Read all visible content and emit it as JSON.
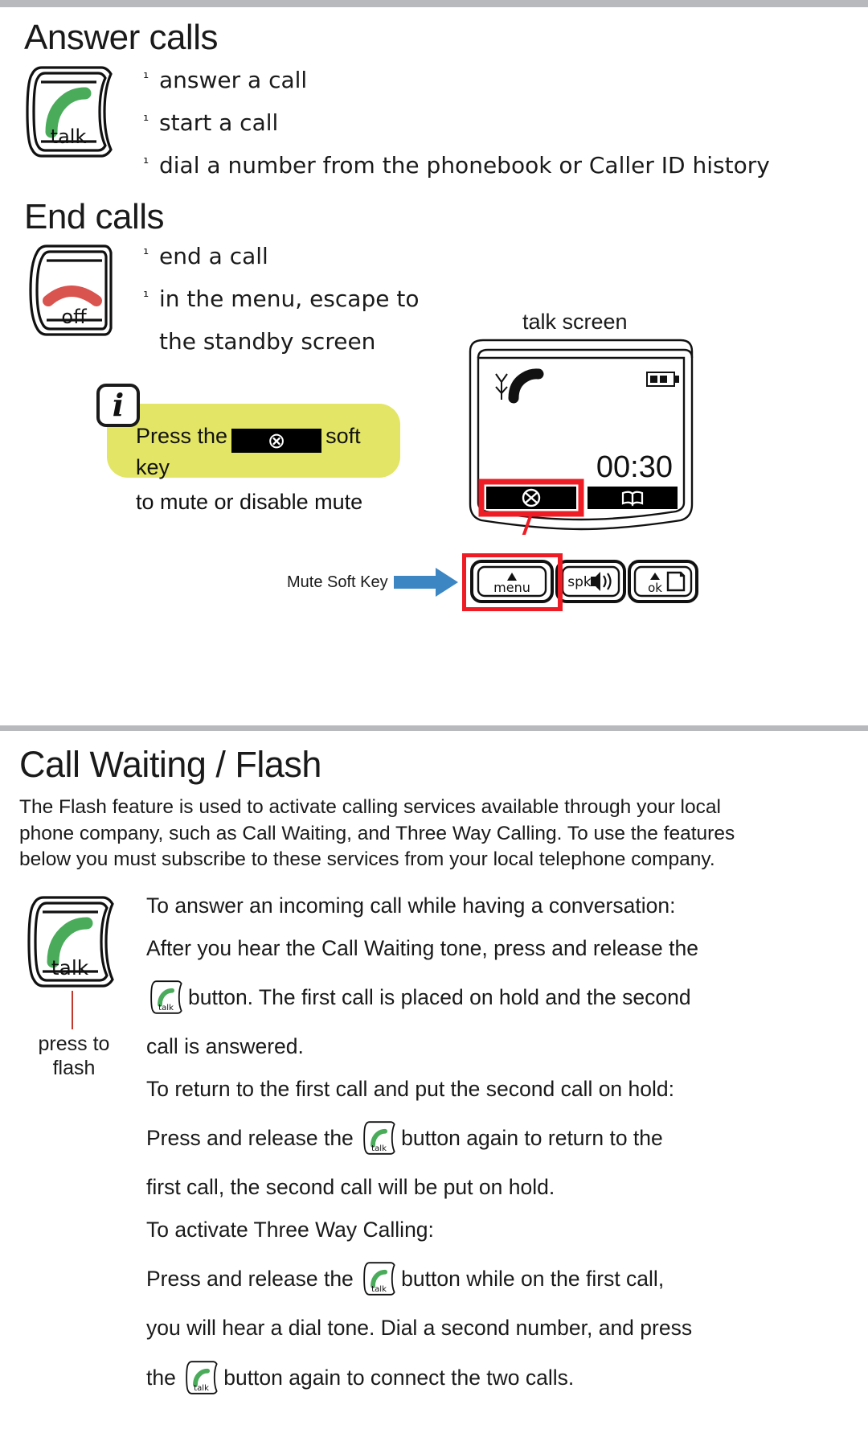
{
  "page": {
    "background": "#ffffff",
    "rule_color": "#b7b9bc"
  },
  "sections": {
    "answer_calls": {
      "title": "Answer calls",
      "key": {
        "label": "talk",
        "icon": "handset-green-icon",
        "color": "#4aac5b"
      },
      "bullets": [
        {
          "mark": "¹",
          "text": "answer a call"
        },
        {
          "mark": "¹",
          "text": "start a call"
        },
        {
          "mark": "¹",
          "text": "dial a number from the phonebook or Caller ID history"
        }
      ]
    },
    "end_calls": {
      "title": "End calls",
      "key": {
        "label": "off",
        "icon": "handset-red-icon",
        "color": "#d9534f"
      },
      "bullets": [
        {
          "mark": "¹",
          "text": "end a call"
        },
        {
          "mark": "¹",
          "text": "in the menu, escape to"
        },
        {
          "mark": "",
          "text": "the standby screen"
        }
      ]
    },
    "callout": {
      "icon": "info-icon",
      "icon_glyph": "i",
      "background": "#e3e566",
      "line1_before": "Press the",
      "softkey_glyph": "⊗",
      "softkey_name": "mute-icon",
      "line1_after": "soft key",
      "line2": "to mute or disable mute"
    },
    "talk_screen": {
      "label": "talk screen",
      "status_icons": [
        "antenna-icon",
        "handset-icon",
        "battery-icon"
      ],
      "timer": "00:30",
      "softkeys": [
        {
          "name": "mute-softkey",
          "glyph": "⊗",
          "highlighted": true,
          "highlight_color": "#ee1c25"
        },
        {
          "name": "phonebook-softkey",
          "glyph": "book-icon",
          "highlighted": false
        }
      ],
      "callout_label": "Mute Soft Key",
      "arrow_color": "#3c86c4",
      "hardware_buttons": [
        {
          "name": "menu-button",
          "label": "menu",
          "icon": "up-arrow-icon",
          "highlighted": true
        },
        {
          "name": "speaker-button",
          "label": "spk",
          "icon": "speaker-icon",
          "highlighted": false
        },
        {
          "name": "ok-button",
          "label": "ok",
          "icon": "page-icon",
          "highlighted": false
        }
      ]
    },
    "call_waiting": {
      "title": "Call Waiting / Flash",
      "intro": "The Flash feature is used to activate calling services available through your local phone company, such as Call Waiting, and Three Way Calling. To use the features below you must subscribe to these services from your local telephone company.",
      "key": {
        "label": "talk",
        "icon": "handset-green-icon",
        "color": "#4aac5b"
      },
      "key_caption_line1": "press to",
      "key_caption_line2": "flash",
      "leader_color": "#c0392b",
      "paragraphs": [
        {
          "id": "p1",
          "parts": [
            {
              "type": "text",
              "value": "To answer an incoming call while having a conversation:"
            }
          ]
        },
        {
          "id": "p2",
          "parts": [
            {
              "type": "text",
              "value": "After you hear the Call Waiting tone, press and release the"
            }
          ]
        },
        {
          "id": "p3",
          "parts": [
            {
              "type": "key",
              "value": "talk"
            },
            {
              "type": "text",
              "value": "button. The first call is placed on hold and the second"
            }
          ]
        },
        {
          "id": "p4",
          "parts": [
            {
              "type": "text",
              "value": "call is answered."
            }
          ]
        },
        {
          "id": "p5",
          "parts": [
            {
              "type": "text",
              "value": "To return to the first call and put the second call on hold:"
            }
          ]
        },
        {
          "id": "p6",
          "parts": [
            {
              "type": "text",
              "value": "Press and release the"
            },
            {
              "type": "key",
              "value": "talk"
            },
            {
              "type": "text",
              "value": "button again to return to the"
            }
          ]
        },
        {
          "id": "p7",
          "parts": [
            {
              "type": "text",
              "value": "first call, the second call will be put on hold."
            }
          ]
        },
        {
          "id": "p8",
          "parts": [
            {
              "type": "text",
              "value": "To activate Three Way Calling:"
            }
          ]
        },
        {
          "id": "p9",
          "parts": [
            {
              "type": "text",
              "value": "Press and release the"
            },
            {
              "type": "key",
              "value": "talk"
            },
            {
              "type": "text",
              "value": "button while on the first call,"
            }
          ]
        },
        {
          "id": "p10",
          "parts": [
            {
              "type": "text",
              "value": "you will hear a dial tone. Dial a second number, and press"
            }
          ]
        },
        {
          "id": "p11",
          "parts": [
            {
              "type": "text",
              "value": "the"
            },
            {
              "type": "key",
              "value": "talk"
            },
            {
              "type": "text",
              "value": "button again to connect the two calls."
            }
          ]
        }
      ],
      "line_texts": {
        "l1": "To answer an incoming call while having a conversation:",
        "l2": "After you hear the Call Waiting tone, press and release the",
        "l3a": "button. The first call is placed on hold and the second",
        "l4": "call is answered.",
        "l5": "To return to the first call and put the second call on hold:",
        "l6a": "Press and release the",
        "l6b": "button again to return to the",
        "l7": "first call, the second call will be put on hold.",
        "l8": "To activate Three Way Calling:",
        "l9a": "Press and release the",
        "l9b": "button while on the first call,",
        "l10": "you will hear a dial tone. Dial a second number, and press",
        "l11a": "the",
        "l11b": "button again to connect the two calls."
      }
    }
  }
}
